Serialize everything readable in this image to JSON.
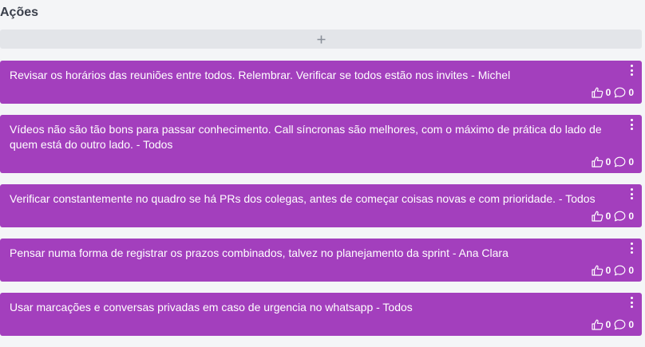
{
  "column": {
    "title": "Ações",
    "add_icon": "plus-icon"
  },
  "colors": {
    "card": "#a33fbd",
    "add_bar": "#e3e5e9",
    "background": "#f4f5f7"
  },
  "cards": [
    {
      "text": "Revisar os horários das reuniões entre todos. Relembrar. Verificar se todos estão nos invites - Michel",
      "likes": "0",
      "comments": "0"
    },
    {
      "text": "Vídeos não são tão bons para passar conhecimento. Call síncronas são melhores, com o máximo de prática do lado de quem está do outro lado. - Todos",
      "likes": "0",
      "comments": "0"
    },
    {
      "text": "Verificar constantemente no quadro se há PRs dos colegas, antes de começar coisas novas e com prioridade. - Todos",
      "likes": "0",
      "comments": "0"
    },
    {
      "text": "Pensar numa forma de registrar os prazos combinados, talvez no planejamento da sprint - Ana Clara",
      "likes": "0",
      "comments": "0"
    },
    {
      "text": "Usar marcações e conversas privadas em caso de urgencia no whatsapp - Todos",
      "likes": "0",
      "comments": "0"
    }
  ]
}
